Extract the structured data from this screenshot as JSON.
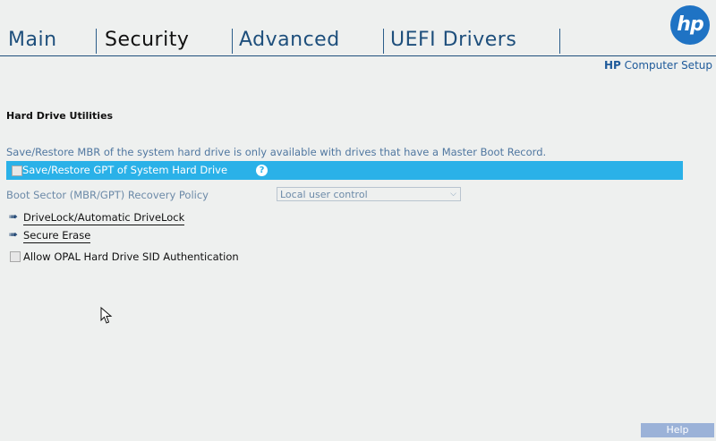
{
  "tabs": [
    {
      "label": "Main",
      "active": false
    },
    {
      "label": "Security",
      "active": true
    },
    {
      "label": "Advanced",
      "active": false
    },
    {
      "label": "UEFI Drivers",
      "active": false
    }
  ],
  "brand": {
    "logo_text": "hp",
    "subtitle_prefix": "HP",
    "subtitle_rest": " Computer Setup"
  },
  "section": {
    "title": "Hard Drive Utilities"
  },
  "info": {
    "text": "Save/Restore MBR of the system hard drive is only available with drives that have a Master Boot Record."
  },
  "highlight": {
    "label": "Save/Restore GPT of System Hard Drive",
    "help_glyph": "?",
    "checked": false
  },
  "recovery_policy": {
    "label": "Boot Sector (MBR/GPT) Recovery Policy",
    "value": "Local user control"
  },
  "nav": [
    {
      "label": "DriveLock/Automatic DriveLock"
    },
    {
      "label": "Secure Erase"
    }
  ],
  "opal": {
    "label": "Allow OPAL Hard Drive SID Authentication",
    "checked": false
  },
  "footer": {
    "help_label": "Help"
  },
  "colors": {
    "accent": "#2ab1e8",
    "tab_text": "#1e4f7c",
    "logo": "#1f73c4"
  }
}
